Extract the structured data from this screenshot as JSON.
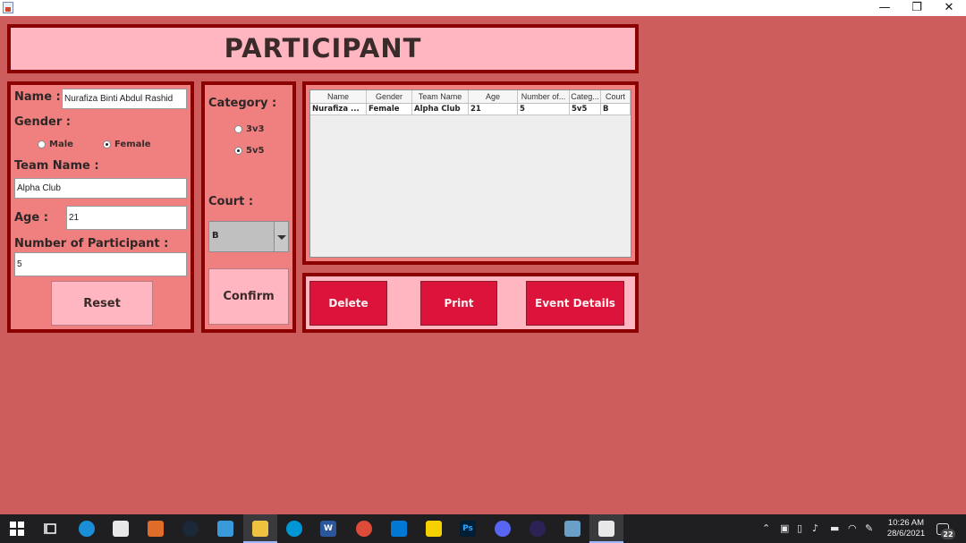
{
  "window": {
    "minimize_glyph": "—",
    "restore_glyph": "❐",
    "close_glyph": "✕"
  },
  "header": {
    "title": "PARTICIPANT"
  },
  "form": {
    "name_label": "Name :",
    "name_value": "Nurafiza Binti Abdul Rashid",
    "gender_label": "Gender :",
    "gender_male": "Male",
    "gender_female": "Female",
    "gender_selected": "Female",
    "team_label": "Team Name :",
    "team_value": "Alpha Club",
    "age_label": "Age :",
    "age_value": "21",
    "participants_label": "Number of Participant :",
    "participants_value": "5",
    "reset_label": "Reset"
  },
  "category": {
    "label": "Category :",
    "option_3v3": "3v3",
    "option_5v5": "5v5",
    "selected": "5v5",
    "court_label": "Court :",
    "court_value": "B",
    "confirm_label": "Confirm"
  },
  "table": {
    "columns": [
      "Name",
      "Gender",
      "Team Name",
      "Age",
      "Number of...",
      "Categ...",
      "Court"
    ],
    "rows": [
      [
        "Nurafiza ...",
        "Female",
        "Alpha Club",
        "21",
        "5",
        "5v5",
        "B"
      ]
    ]
  },
  "actions": {
    "delete_label": "Delete",
    "print_label": "Print",
    "event_details_label": "Event Details"
  },
  "taskbar": {
    "ps_label": "Ps",
    "word_label": "W",
    "clock_time": "10:26 AM",
    "clock_date": "28/6/2021",
    "notification_count": "22"
  },
  "colors": {
    "background": "#cd5c5c",
    "panel": "#f08080",
    "panel_border": "#8b0000",
    "title_panel": "#ffb6c1",
    "action_button": "#dc143c"
  }
}
